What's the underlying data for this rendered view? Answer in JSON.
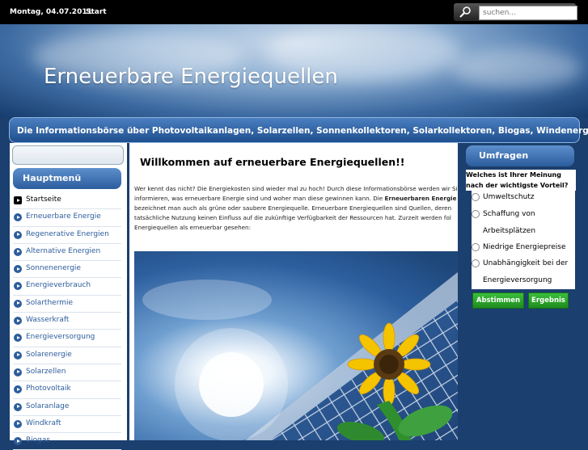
{
  "topbar": {
    "date": "Montag, 04.07.2011",
    "start_label": "Start"
  },
  "search": {
    "placeholder": "suchen...",
    "icon": "magnifier-icon"
  },
  "header": {
    "title": "Erneuerbare Energiequellen"
  },
  "subtitle": "Die Informationsbörse über Photovoltaikanlagen, Solarzellen, Sonnenkollektoren, Solarkollektoren, Biogas, Windenergie,",
  "sidebar": {
    "heading": "Hauptmenü",
    "items": [
      {
        "label": "Startseite",
        "active": true
      },
      {
        "label": "Erneuerbare Energie"
      },
      {
        "label": "Regenerative Energien"
      },
      {
        "label": "Alternative Energien"
      },
      {
        "label": "Sonnenenergie"
      },
      {
        "label": "Energieverbrauch"
      },
      {
        "label": "Solarthermie"
      },
      {
        "label": "Wasserkraft"
      },
      {
        "label": "Energieversorgung"
      },
      {
        "label": "Solarenergie"
      },
      {
        "label": "Solarzellen"
      },
      {
        "label": "Photovoltaik"
      },
      {
        "label": "Solaranlage"
      },
      {
        "label": "Windkraft"
      },
      {
        "label": "Biogas"
      }
    ]
  },
  "main": {
    "heading": "Willkommen auf erneuerbare Energiequellen!!",
    "intro_lines": [
      "Wer kennt das nicht? Die Energiekosten sind wieder mal zu hoch! Durch diese Informationsbörse werden wir Sie",
      "informieren, was erneuerbare Energie sind und woher man diese gewinnen kann. Die ",
      "Erneuerbaren Energie",
      "bezeichnet man auch als grüne oder saubere Energiequelle. Erneuerbare Energiequellen sind Quellen, deren",
      "tatsächliche Nutzung keinen Einfluss auf die zukünftige Verfügbarkeit der Ressourcen hat. Zurzeit werden fol",
      "Energiequellen als erneuerbar gesehen:"
    ]
  },
  "poll": {
    "heading": "Umfragen",
    "question": "Welches ist Ihrer Meinung nach der wichtigste Vorteil?",
    "options": [
      "Umweltschutz",
      "Schaffung von Arbeitsplätzen",
      "Niedrige Energiepreise",
      "Unabhängigkeit bei der Energieversorgung"
    ],
    "vote_label": "Abstimmen",
    "results_label": "Ergebnis"
  },
  "colors": {
    "accent": "#2c5d9c",
    "button": "#2aa62a",
    "topbar": "#000000"
  }
}
